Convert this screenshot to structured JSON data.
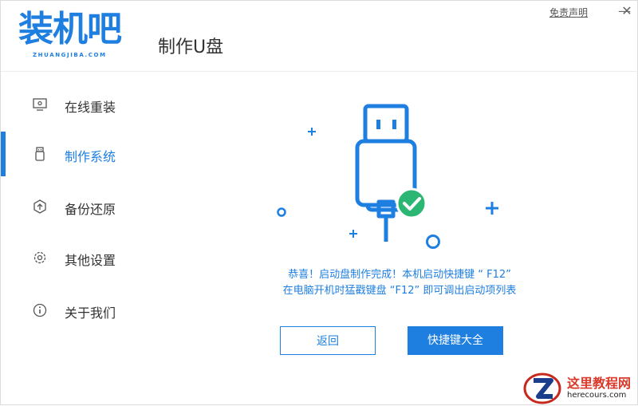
{
  "header": {
    "logo_text": "装机吧",
    "logo_sub": "ZHUANGJIBA.COM",
    "page_title": "制作U盘",
    "disclaimer": "免责声明",
    "minimize": "—",
    "close": "✕"
  },
  "sidebar": {
    "items": [
      {
        "label": "在线重装",
        "icon": "monitor-icon"
      },
      {
        "label": "制作系统",
        "icon": "usb-icon"
      },
      {
        "label": "备份还原",
        "icon": "backup-icon"
      },
      {
        "label": "其他设置",
        "icon": "gear-icon"
      },
      {
        "label": "关于我们",
        "icon": "info-icon"
      }
    ],
    "active_index": 1
  },
  "main": {
    "message_line1": "恭喜！启动盘制作完成！本机启动快捷键 “ F12”",
    "message_line2": "在电脑开机时猛戳键盘 “F12” 即可调出启动项列表",
    "back_button": "返回",
    "shortcut_button": "快捷键大全"
  },
  "watermark": {
    "title": "这里教程网",
    "url": "herecours.com"
  },
  "colors": {
    "accent": "#1e7fe0",
    "success": "#2bb673"
  }
}
